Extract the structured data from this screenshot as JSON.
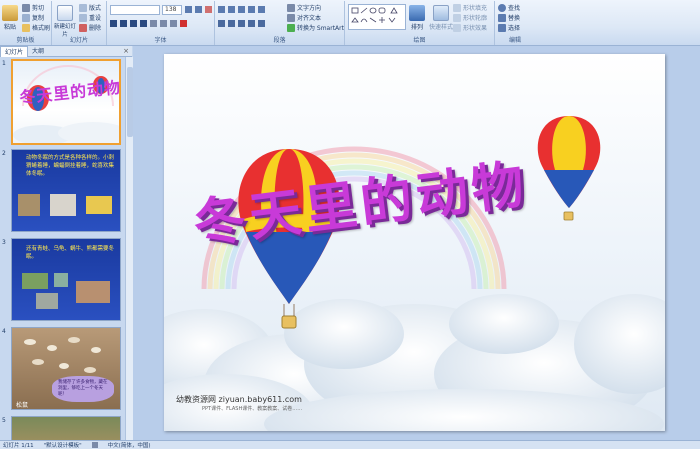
{
  "ribbon": {
    "clipboard": {
      "paste": "粘贴",
      "cut": "剪切",
      "copy": "复制",
      "format_painter": "格式刷",
      "label": "剪贴板"
    },
    "slides": {
      "new_slide": "新建幻灯片",
      "layout": "版式",
      "reset": "重设",
      "delete": "删除",
      "label": "幻灯片"
    },
    "font": {
      "size": "138",
      "label": "字体"
    },
    "paragraph": {
      "text_direction": "文字方向",
      "align_text": "对齐文本",
      "smartart": "转换为 SmartArt",
      "label": "段落"
    },
    "drawing": {
      "arrange": "排列",
      "quick_styles": "快速样式",
      "shape_fill": "形状填充",
      "shape_outline": "形状轮廓",
      "shape_effects": "形状效果",
      "label": "绘图"
    },
    "editing": {
      "find": "查找",
      "replace": "替换",
      "select": "选择",
      "label": "编辑"
    }
  },
  "panel_tabs": {
    "slides": "幻灯片",
    "outline": "大纲"
  },
  "thumbnails": [
    {
      "num": "1",
      "title": "冬天里的动物"
    },
    {
      "num": "2",
      "text": "动物冬眠的方式是各种各样的。小刺猬蜷着睡，蝙蝠倒挂着睡，蛇喜欢集体冬眠。"
    },
    {
      "num": "3",
      "text": "还有青蛙、乌龟、蜗牛、熊都需要冬眠。"
    },
    {
      "num": "4",
      "text": "我储存了许多食物，藏在洞里，够吃上一个冬天呢！",
      "tag": "松鼠"
    },
    {
      "num": "5"
    }
  ],
  "slide": {
    "title": "冬天里的动物",
    "footer": "幼教资源网 ziyuan.baby611.com",
    "footer_sub": "PPT课件、FLASH课件、教案教案、试卷……"
  },
  "status": {
    "slide": "幻灯片 1/11",
    "theme": "\"默认设计模板\"",
    "lang": "中文(简体，中国)"
  },
  "colors": {
    "title": "#c83ad8",
    "ribbon_bg": "#dde8f6",
    "selected_border": "#f0a030"
  }
}
